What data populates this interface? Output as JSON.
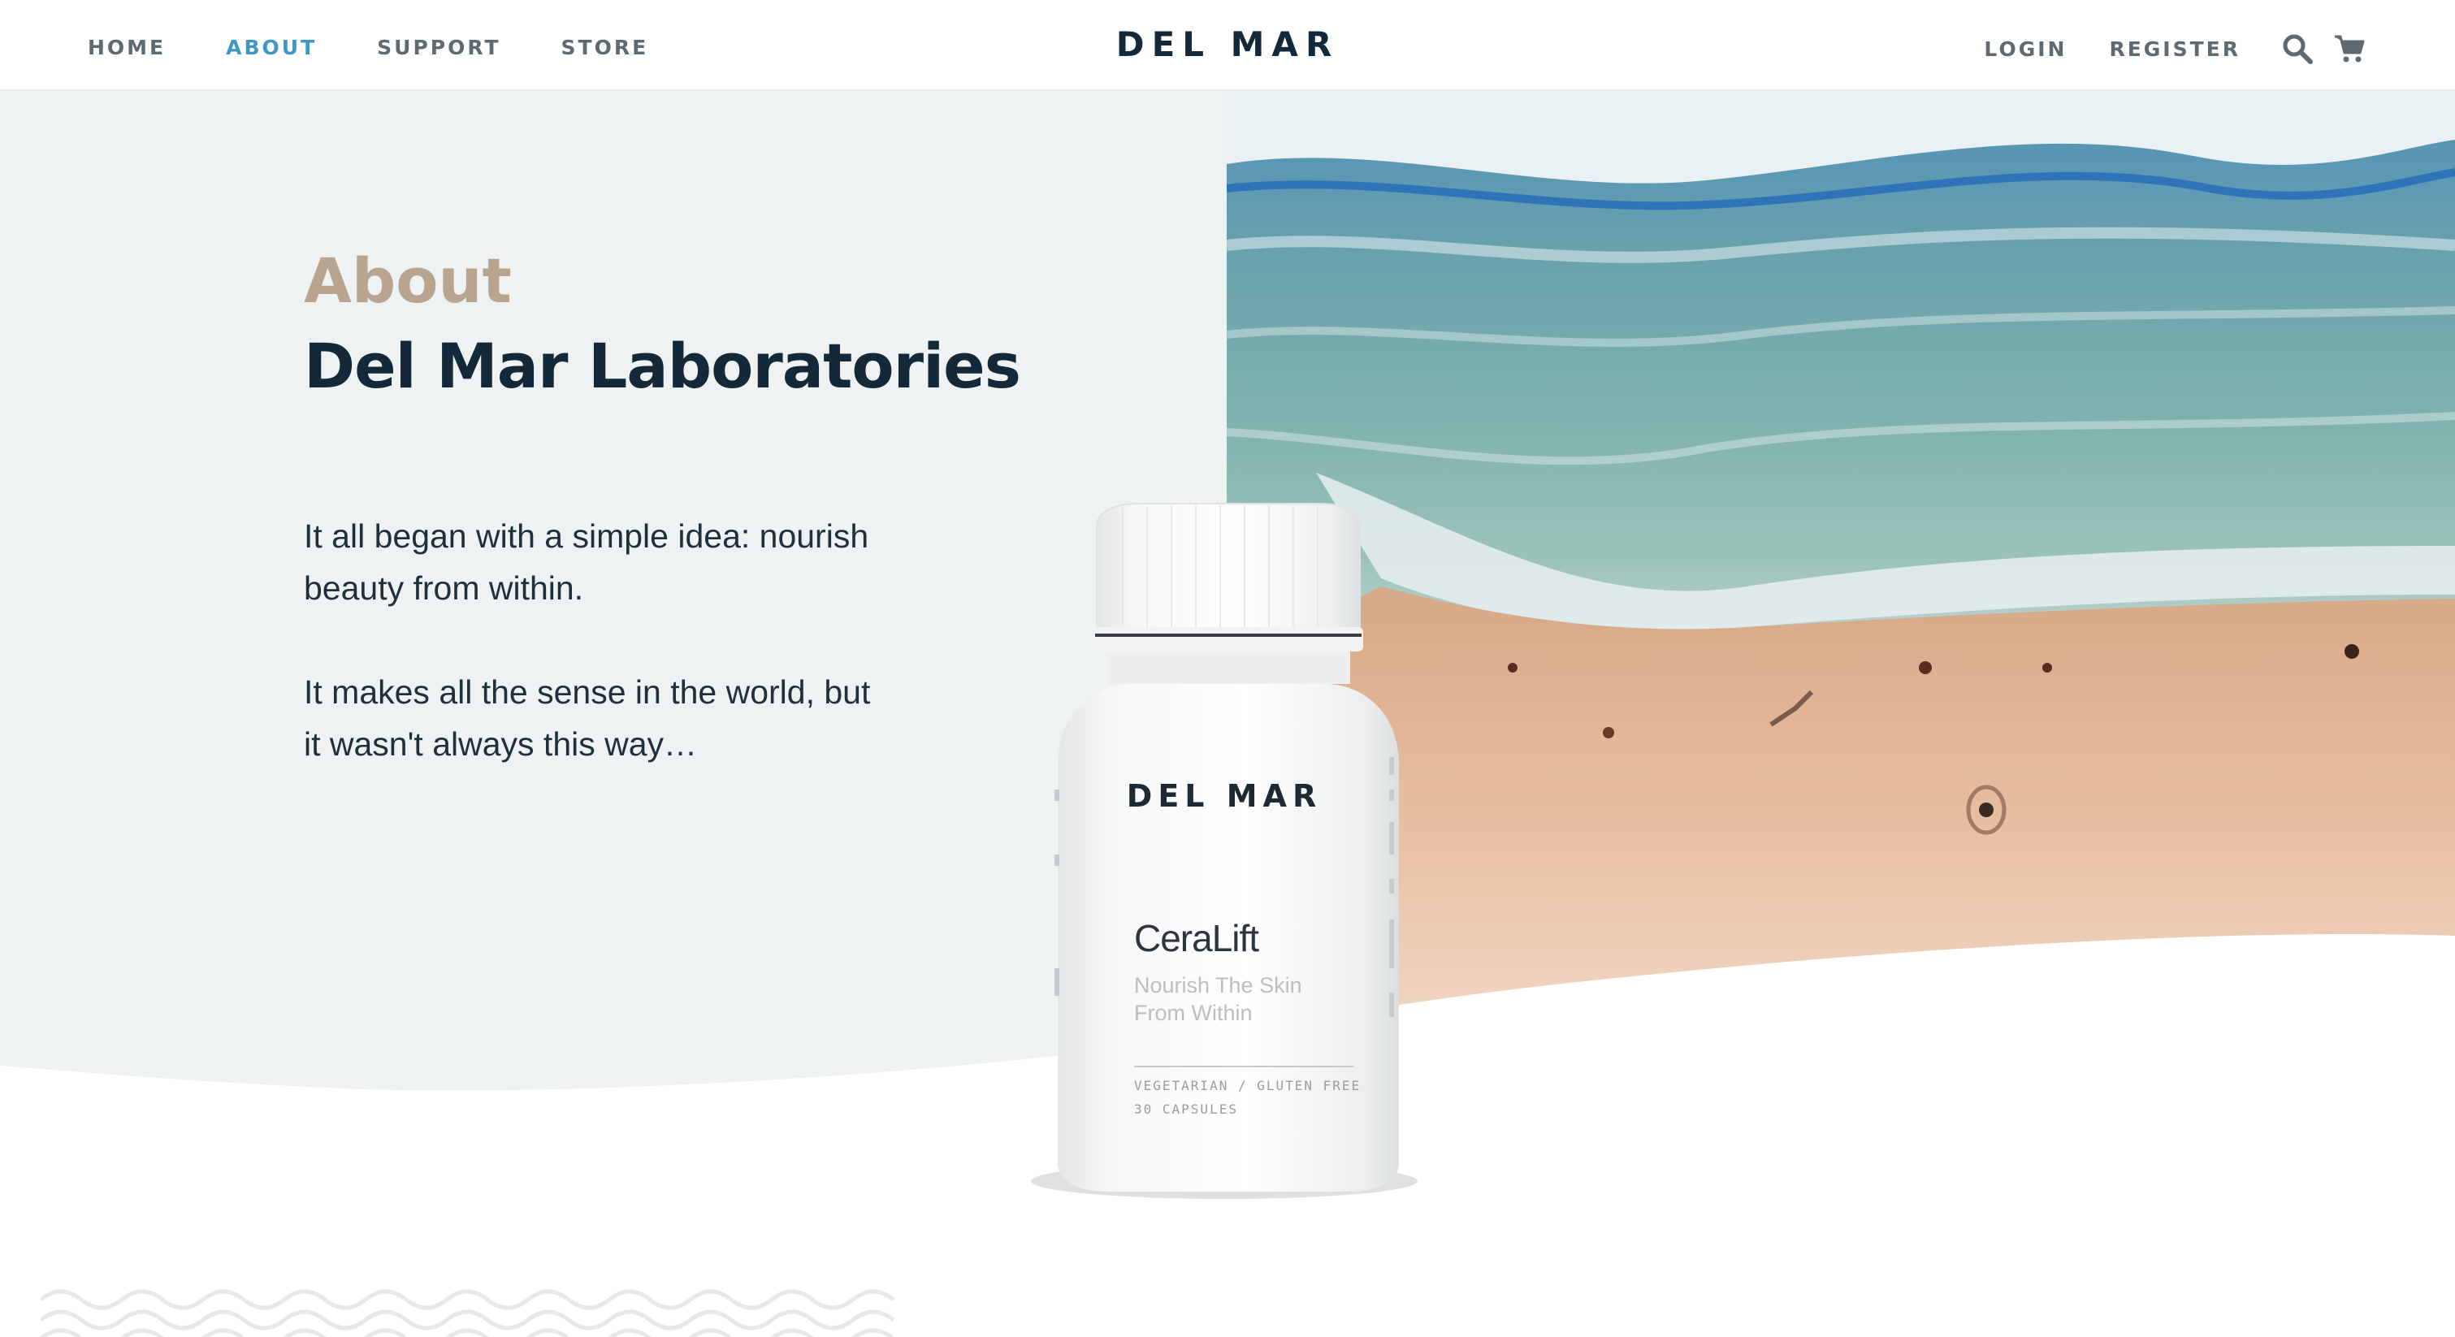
{
  "nav": {
    "items": [
      {
        "label": "HOME",
        "active": false
      },
      {
        "label": "ABOUT",
        "active": true
      },
      {
        "label": "SUPPORT",
        "active": false
      },
      {
        "label": "STORE",
        "active": false
      }
    ],
    "brand": "DEL MAR",
    "login": "LOGIN",
    "register": "REGISTER",
    "search_icon": "search-icon",
    "cart_icon": "cart-icon"
  },
  "hero": {
    "eyebrow": "About",
    "title": "Del Mar Laboratories",
    "paragraph_1": "It all began with a simple idea: nourish beauty from within.",
    "paragraph_2": "It makes all the sense in the world, but it wasn't always this way…"
  },
  "product": {
    "brand": "DEL MAR",
    "name": "CeraLift",
    "tagline": "Nourish The Skin From Within",
    "detail_1": "VEGETARIAN / GLUTEN FREE",
    "detail_2": "30 CAPSULES"
  },
  "colors": {
    "accent": "#3f97c7",
    "navy": "#13293a",
    "tan": "#b9a48f",
    "hero_panel": "#eff2f3"
  }
}
